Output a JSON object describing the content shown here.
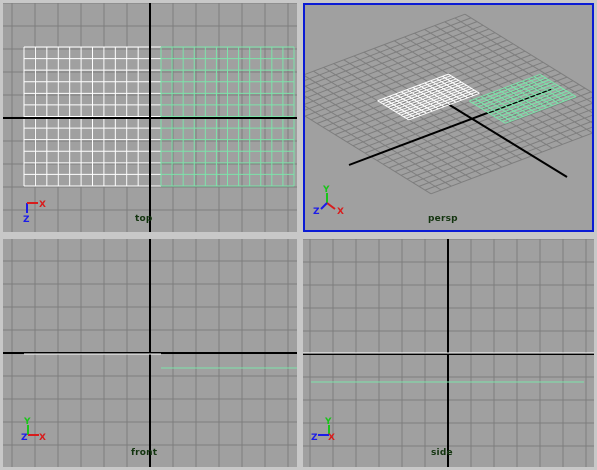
{
  "viewports": {
    "top": {
      "label": "top",
      "axis_a": "X",
      "axis_b": "Z"
    },
    "persp": {
      "label": "persp",
      "axis_a": "Y",
      "axis_b": "Z",
      "axis_c": "X"
    },
    "front": {
      "label": "front",
      "axis_a": "Y",
      "axis_b": "Z",
      "axis_c": "X"
    },
    "side": {
      "label": "side",
      "axis_a": "Y",
      "axis_b": "Z",
      "axis_c": "X"
    }
  },
  "colors": {
    "background": "#a0a0a0",
    "grid": "#7e7e7e",
    "axis": "#000000",
    "white_object": "#ffffff",
    "green_object": "#7de3aa",
    "active_border": "#0b1bd4",
    "axis_x": "#d81c1c",
    "axis_y": "#19c419",
    "axis_z": "#1c1ce8"
  }
}
